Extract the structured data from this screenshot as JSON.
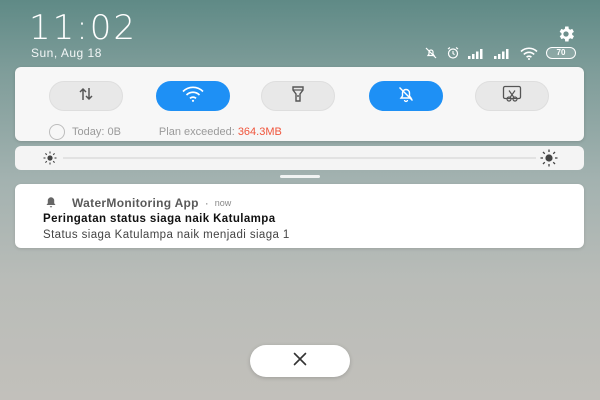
{
  "status_bar": {
    "time": "11:02",
    "date": "Sun, Aug 18",
    "battery_level": "70",
    "icons": [
      "do-not-disturb-icon",
      "alarm-icon",
      "signal-icon",
      "signal-icon",
      "wifi-icon",
      "battery-icon"
    ]
  },
  "quick_settings": {
    "toggles": [
      {
        "name": "mobile-data",
        "icon": "data-arrows-icon",
        "active": false
      },
      {
        "name": "wifi",
        "icon": "wifi-icon",
        "active": true
      },
      {
        "name": "flashlight",
        "icon": "flashlight-icon",
        "active": false
      },
      {
        "name": "silent",
        "icon": "bell-off-icon",
        "active": true
      },
      {
        "name": "screenshot",
        "icon": "scissors-icon",
        "active": false
      }
    ],
    "data_today": "Today: 0B",
    "plan_label": "Plan exceeded: ",
    "plan_value": "364.3MB",
    "accent_color": "#1e90f5",
    "warning_color": "#f0553c"
  },
  "notification": {
    "app_name": "WaterMonitoring App",
    "separator": "·",
    "time": "now",
    "title": "Peringatan status siaga naik Katulampa",
    "body": "Status siaga Katulampa naik menjadi siaga 1"
  }
}
